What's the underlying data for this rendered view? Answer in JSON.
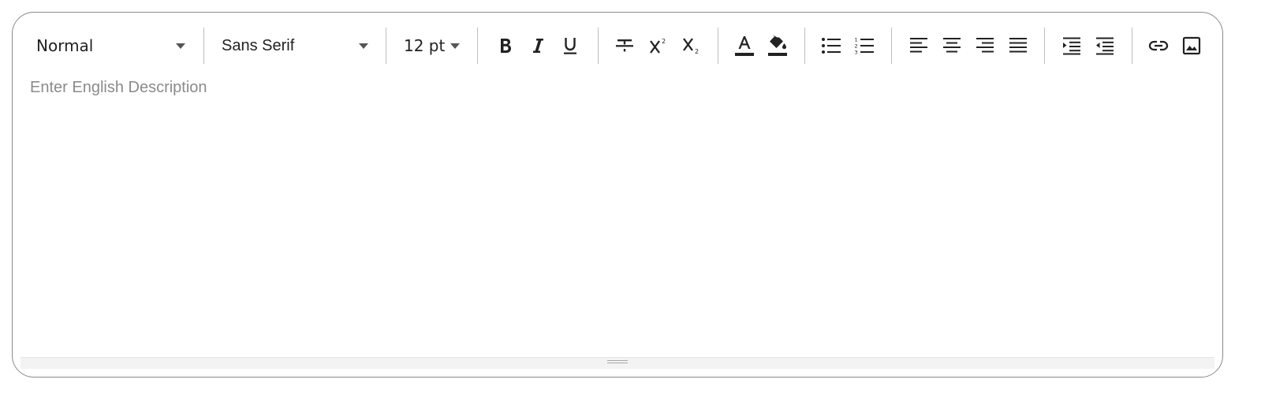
{
  "toolbar": {
    "header_select": {
      "value": "Normal"
    },
    "font_select": {
      "value": "Sans Serif"
    },
    "size_select": {
      "value": "12 pt"
    },
    "buttons": [
      {
        "name": "bold",
        "icon": "bold-icon"
      },
      {
        "name": "italic",
        "icon": "italic-icon"
      },
      {
        "name": "underline",
        "icon": "underline-icon"
      },
      {
        "name": "strikethrough",
        "icon": "strikethrough-icon"
      },
      {
        "name": "superscript",
        "icon": "superscript-icon"
      },
      {
        "name": "subscript",
        "icon": "subscript-icon"
      },
      {
        "name": "text-color",
        "icon": "text-color-icon"
      },
      {
        "name": "background-color",
        "icon": "fill-color-icon"
      },
      {
        "name": "bullet-list",
        "icon": "bullet-list-icon"
      },
      {
        "name": "ordered-list",
        "icon": "numbered-list-icon"
      },
      {
        "name": "align-left",
        "icon": "align-left-icon"
      },
      {
        "name": "align-center",
        "icon": "align-center-icon"
      },
      {
        "name": "align-right",
        "icon": "align-right-icon"
      },
      {
        "name": "align-justify",
        "icon": "align-justify-icon"
      },
      {
        "name": "indent",
        "icon": "indent-icon"
      },
      {
        "name": "outdent",
        "icon": "outdent-icon"
      },
      {
        "name": "link",
        "icon": "link-icon"
      },
      {
        "name": "image",
        "icon": "image-icon"
      }
    ]
  },
  "editor": {
    "placeholder": "Enter English Description"
  },
  "colors": {
    "icon": "#222222",
    "border": "#8a8a8a",
    "placeholder": "#8b8b8b",
    "separator": "#bdbdbd"
  }
}
